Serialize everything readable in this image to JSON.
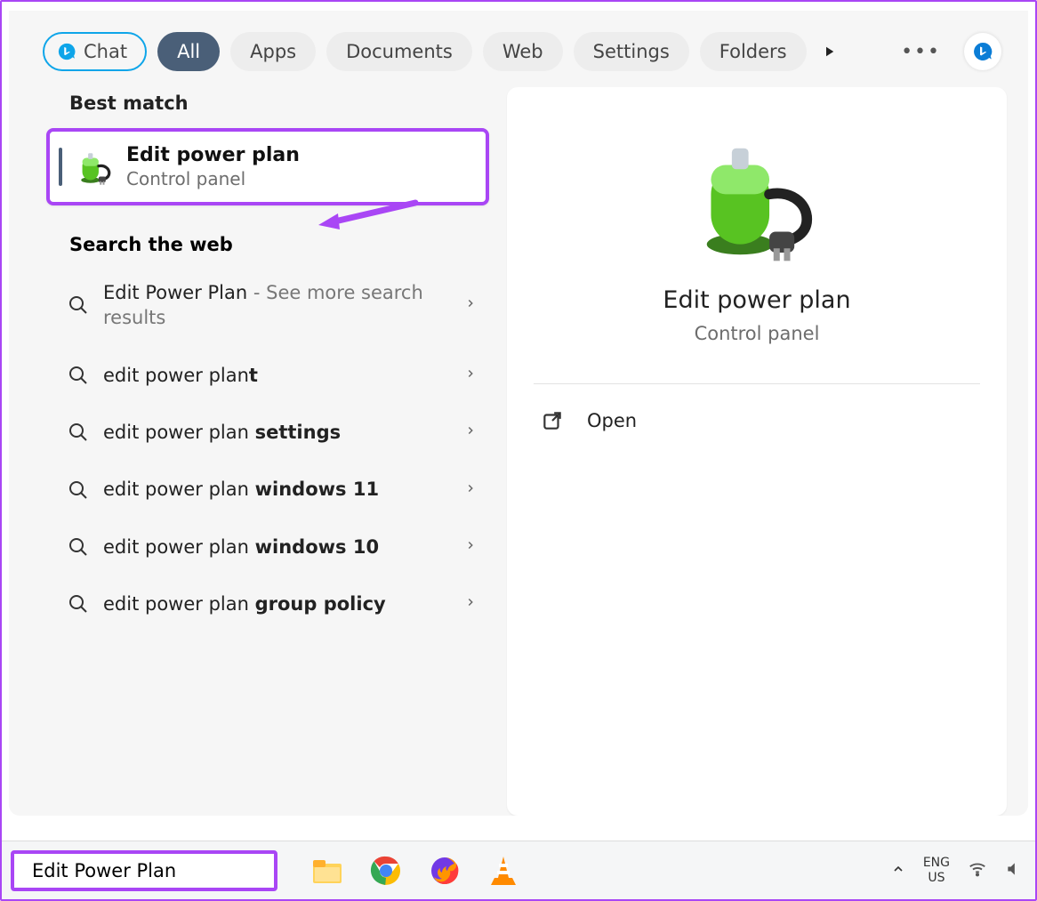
{
  "filters": {
    "chat": "Chat",
    "tabs": [
      "All",
      "Apps",
      "Documents",
      "Web",
      "Settings",
      "Folders"
    ],
    "activeIndex": 0
  },
  "sections": {
    "bestMatchHeading": "Best match",
    "webHeading": "Search the web"
  },
  "bestMatch": {
    "title": "Edit power plan",
    "subtitle": "Control panel"
  },
  "webResults": [
    {
      "prefix": "Edit Power Plan",
      "suffix": " - See more search results",
      "boldSuffix": ""
    },
    {
      "prefix": "edit power plan",
      "suffix": "",
      "boldSuffix": "t"
    },
    {
      "prefix": "edit power plan ",
      "suffix": "",
      "boldSuffix": "settings"
    },
    {
      "prefix": "edit power plan ",
      "suffix": "",
      "boldSuffix": "windows 11"
    },
    {
      "prefix": "edit power plan ",
      "suffix": "",
      "boldSuffix": "windows 10"
    },
    {
      "prefix": "edit power plan ",
      "suffix": "",
      "boldSuffix": "group policy"
    }
  ],
  "preview": {
    "title": "Edit power plan",
    "subtitle": "Control panel",
    "openLabel": "Open"
  },
  "taskbar": {
    "searchValue": "Edit Power Plan",
    "langTop": "ENG",
    "langBottom": "US"
  }
}
